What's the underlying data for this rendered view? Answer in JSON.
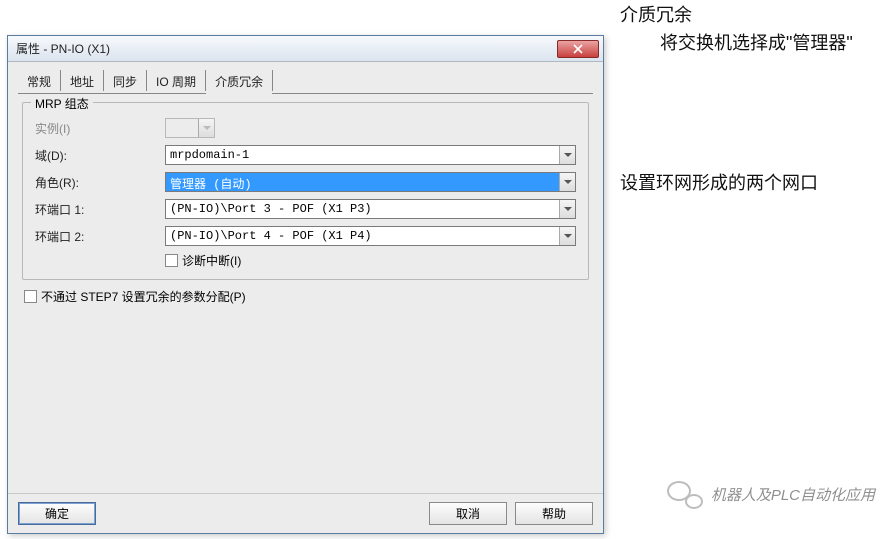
{
  "window": {
    "title": "属性 - PN-IO (X1)"
  },
  "tabs": {
    "t0": "常规",
    "t1": "地址",
    "t2": "同步",
    "t3": "IO 周期",
    "t4": "介质冗余"
  },
  "groupbox": {
    "legend": "MRP 组态"
  },
  "labels": {
    "instance": "实例(I)",
    "domain": "域(D):",
    "role": "角色(R):",
    "port1": "环端口 1:",
    "port2": "环端口 2:",
    "diag_interrupt": "诊断中断(I)",
    "no_step7": "不通过 STEP7 设置冗余的参数分配(P)"
  },
  "values": {
    "instance": "",
    "domain": "mrpdomain-1",
    "role": "管理器 (自动)",
    "port1": "(PN-IO)\\Port 3 - POF (X1 P3)",
    "port2": "(PN-IO)\\Port 4 - POF (X1 P4)"
  },
  "buttons": {
    "ok": "确定",
    "cancel": "取消",
    "help": "帮助"
  },
  "annotations": {
    "a1": "介质冗余",
    "a2": "将交换机选择成\"管理器\"",
    "a3": "设置环网形成的两个网口"
  },
  "watermark": "机器人及PLC自动化应用"
}
